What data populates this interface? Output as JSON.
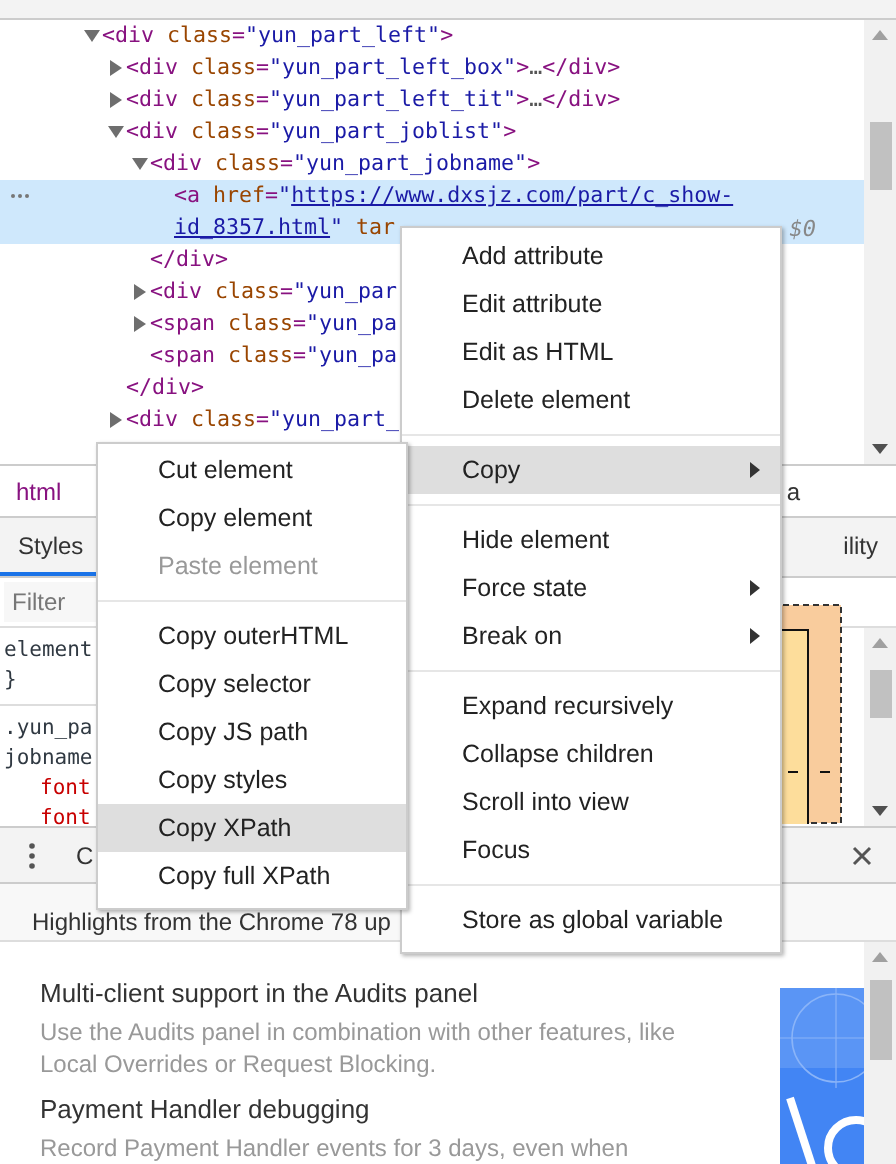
{
  "dom_tree": [
    {
      "lines": [
        [
          {
            "kind": "tag",
            "text": "<div"
          },
          {
            "kind": "attr",
            "text": " class"
          },
          {
            "kind": "punct",
            "text": "="
          },
          {
            "kind": "value",
            "text": "\"yun_part_left\""
          },
          {
            "kind": "tag",
            "text": ">"
          }
        ]
      ],
      "expanded": true,
      "selected": false,
      "children": [
        {
          "lines": [
            [
              {
                "kind": "tag",
                "text": "<div"
              },
              {
                "kind": "attr",
                "text": " class"
              },
              {
                "kind": "punct",
                "text": "="
              },
              {
                "kind": "value",
                "text": "\"yun_part_left_box\""
              },
              {
                "kind": "tag",
                "text": ">"
              },
              {
                "kind": "text",
                "text": "…"
              },
              {
                "kind": "tag",
                "text": "</div>"
              }
            ]
          ],
          "expanded": false,
          "selected": false
        },
        {
          "lines": [
            [
              {
                "kind": "tag",
                "text": "<div"
              },
              {
                "kind": "attr",
                "text": " class"
              },
              {
                "kind": "punct",
                "text": "="
              },
              {
                "kind": "value",
                "text": "\"yun_part_left_tit\""
              },
              {
                "kind": "tag",
                "text": ">"
              },
              {
                "kind": "text",
                "text": "…"
              },
              {
                "kind": "tag",
                "text": "</div>"
              }
            ]
          ],
          "expanded": false,
          "selected": false
        },
        {
          "lines": [
            [
              {
                "kind": "tag",
                "text": "<div"
              },
              {
                "kind": "attr",
                "text": " class"
              },
              {
                "kind": "punct",
                "text": "="
              },
              {
                "kind": "value",
                "text": "\"yun_part_joblist\""
              },
              {
                "kind": "tag",
                "text": ">"
              }
            ]
          ],
          "expanded": true,
          "selected": false,
          "closing": "</div>",
          "children": [
            {
              "lines": [
                [
                  {
                    "kind": "tag",
                    "text": "<div"
                  },
                  {
                    "kind": "attr",
                    "text": " class"
                  },
                  {
                    "kind": "punct",
                    "text": "="
                  },
                  {
                    "kind": "value",
                    "text": "\"yun_part_jobname\""
                  },
                  {
                    "kind": "tag",
                    "text": ">"
                  }
                ]
              ],
              "expanded": true,
              "selected": false,
              "closing": "</div>",
              "children": [
                {
                  "lines": [
                    [
                      {
                        "kind": "tag",
                        "text": "<a"
                      },
                      {
                        "kind": "attr",
                        "text": " href"
                      },
                      {
                        "kind": "punct",
                        "text": "="
                      },
                      {
                        "kind": "value",
                        "text": "\""
                      },
                      {
                        "kind": "link",
                        "text": "https://www.dxsjz.com/part/c_show-"
                      }
                    ],
                    [
                      {
                        "kind": "link",
                        "text": "id_8357.html"
                      },
                      {
                        "kind": "value",
                        "text": "\""
                      },
                      {
                        "kind": "attr",
                        "text": " tar"
                      }
                    ]
                  ],
                  "selected": true,
                  "marker": "$0"
                }
              ]
            },
            {
              "lines": [
                [
                  {
                    "kind": "tag",
                    "text": "<div"
                  },
                  {
                    "kind": "attr",
                    "text": " class"
                  },
                  {
                    "kind": "punct",
                    "text": "="
                  },
                  {
                    "kind": "value",
                    "text": "\"yun_par"
                  }
                ]
              ],
              "expanded": false,
              "selected": false
            },
            {
              "lines": [
                [
                  {
                    "kind": "tag",
                    "text": "<span"
                  },
                  {
                    "kind": "attr",
                    "text": " class"
                  },
                  {
                    "kind": "punct",
                    "text": "="
                  },
                  {
                    "kind": "value",
                    "text": "\"yun_pa"
                  }
                ]
              ],
              "expanded": false,
              "selected": false
            },
            {
              "lines": [
                [
                  {
                    "kind": "tag",
                    "text": "<span"
                  },
                  {
                    "kind": "attr",
                    "text": " class"
                  },
                  {
                    "kind": "punct",
                    "text": "="
                  },
                  {
                    "kind": "value",
                    "text": "\"yun_pa"
                  }
                ]
              ],
              "selected": false
            }
          ]
        },
        {
          "lines": [
            [
              {
                "kind": "tag",
                "text": "<div"
              },
              {
                "kind": "attr",
                "text": " class"
              },
              {
                "kind": "punct",
                "text": "="
              },
              {
                "kind": "value",
                "text": "\"yun_part_"
              }
            ]
          ],
          "expanded": false,
          "selected": false
        }
      ]
    }
  ],
  "breadcrumbs": {
    "left": "html",
    "right": "a"
  },
  "sidebar_tabs": [
    {
      "label": "Styles",
      "selected": true
    },
    {
      "label": "ility",
      "selected": false
    }
  ],
  "filter": {
    "placeholder": "Filter"
  },
  "style_rules": [
    {
      "selector_lines": [
        "element"
      ],
      "closing": "}"
    },
    {
      "selector_lines": [
        ".yun_pa",
        "jobname"
      ],
      "declarations": [
        "font",
        "font"
      ]
    }
  ],
  "drawer": {
    "tab": "C"
  },
  "whats_new": {
    "heading": "Highlights from the Chrome 78 up",
    "items": [
      {
        "title": "Multi-client support in the Audits panel",
        "description": "Use the Audits panel in combination with other features, like Local Overrides or Request Blocking."
      },
      {
        "title": "Payment Handler debugging",
        "description": "Record Payment Handler events for 3 days, even when"
      }
    ]
  },
  "context_menu": {
    "groups": [
      {
        "items": [
          {
            "label": "Add attribute",
            "highlighted": false,
            "disabled": false,
            "submenu": false
          },
          {
            "label": "Edit attribute",
            "highlighted": false,
            "disabled": false,
            "submenu": false
          },
          {
            "label": "Edit as HTML",
            "highlighted": false,
            "disabled": false,
            "submenu": false
          },
          {
            "label": "Delete element",
            "highlighted": false,
            "disabled": false,
            "submenu": false
          }
        ]
      },
      {
        "items": [
          {
            "label": "Copy",
            "highlighted": true,
            "disabled": false,
            "submenu": true
          }
        ]
      },
      {
        "items": [
          {
            "label": "Hide element",
            "highlighted": false,
            "disabled": false,
            "submenu": false
          },
          {
            "label": "Force state",
            "highlighted": false,
            "disabled": false,
            "submenu": true
          },
          {
            "label": "Break on",
            "highlighted": false,
            "disabled": false,
            "submenu": true
          }
        ]
      },
      {
        "items": [
          {
            "label": "Expand recursively",
            "highlighted": false,
            "disabled": false,
            "submenu": false
          },
          {
            "label": "Collapse children",
            "highlighted": false,
            "disabled": false,
            "submenu": false
          },
          {
            "label": "Scroll into view",
            "highlighted": false,
            "disabled": false,
            "submenu": false
          },
          {
            "label": "Focus",
            "highlighted": false,
            "disabled": false,
            "submenu": false
          }
        ]
      },
      {
        "items": [
          {
            "label": "Store as global variable",
            "highlighted": false,
            "disabled": false,
            "submenu": false
          }
        ]
      }
    ]
  },
  "copy_submenu": {
    "groups": [
      {
        "items": [
          {
            "label": "Cut element",
            "highlighted": false,
            "disabled": false,
            "submenu": false
          },
          {
            "label": "Copy element",
            "highlighted": false,
            "disabled": false,
            "submenu": false
          },
          {
            "label": "Paste element",
            "highlighted": false,
            "disabled": true,
            "submenu": false
          }
        ]
      },
      {
        "items": [
          {
            "label": "Copy outerHTML",
            "highlighted": false,
            "disabled": false,
            "submenu": false
          },
          {
            "label": "Copy selector",
            "highlighted": false,
            "disabled": false,
            "submenu": false
          },
          {
            "label": "Copy JS path",
            "highlighted": false,
            "disabled": false,
            "submenu": false
          },
          {
            "label": "Copy styles",
            "highlighted": false,
            "disabled": false,
            "submenu": false
          },
          {
            "label": "Copy XPath",
            "highlighted": true,
            "disabled": false,
            "submenu": false
          },
          {
            "label": "Copy full XPath",
            "highlighted": false,
            "disabled": false,
            "submenu": false
          }
        ]
      }
    ]
  }
}
